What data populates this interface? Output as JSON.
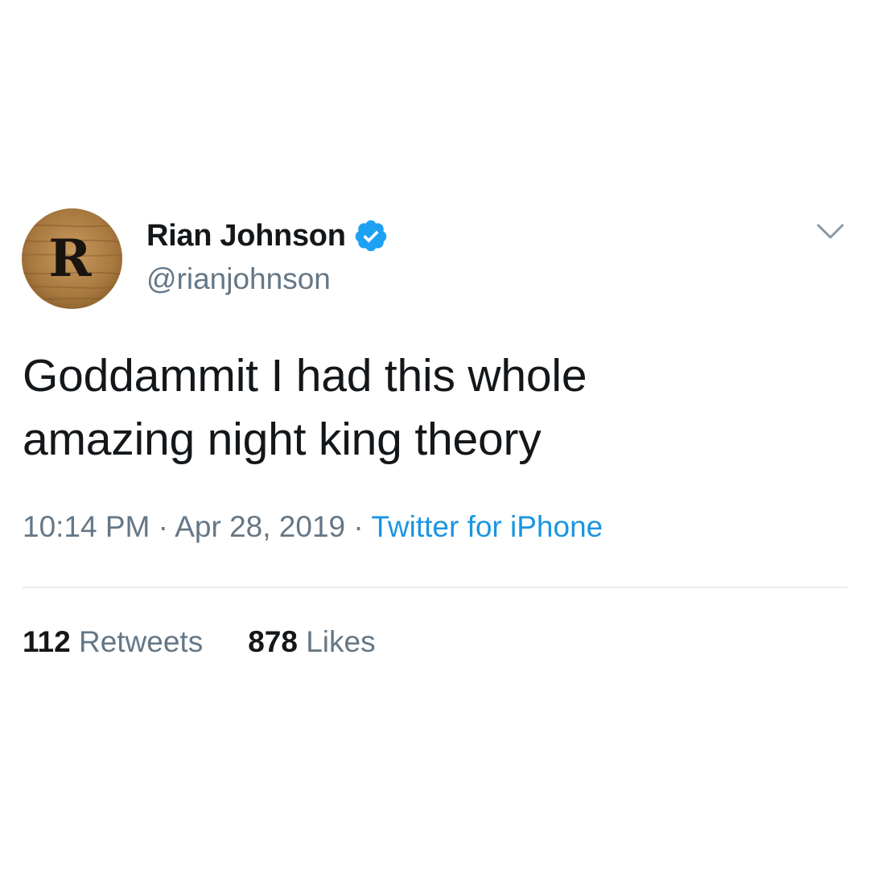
{
  "tweet": {
    "author": {
      "display_name": "Rian Johnson",
      "handle": "@rianjohnson",
      "verified": true,
      "avatar_letter": "R"
    },
    "text_lines": [
      "Goddammit I had this whole",
      "amazing night king theory"
    ],
    "meta": {
      "time": "10:14 PM",
      "separator": " · ",
      "date": "Apr 28, 2019",
      "source": "Twitter for iPhone"
    },
    "stats": {
      "retweets_count": "112",
      "retweets_label": " Retweets",
      "likes_count": "878",
      "likes_label": " Likes"
    }
  },
  "icons": {
    "verified": "verified-badge-icon",
    "more": "chevron-down-icon"
  },
  "colors": {
    "text_primary": "#14171a",
    "text_secondary": "#657786",
    "link": "#1b95e0",
    "verified": "#1da1f2",
    "divider": "#e6ecf0",
    "background": "#ffffff"
  }
}
